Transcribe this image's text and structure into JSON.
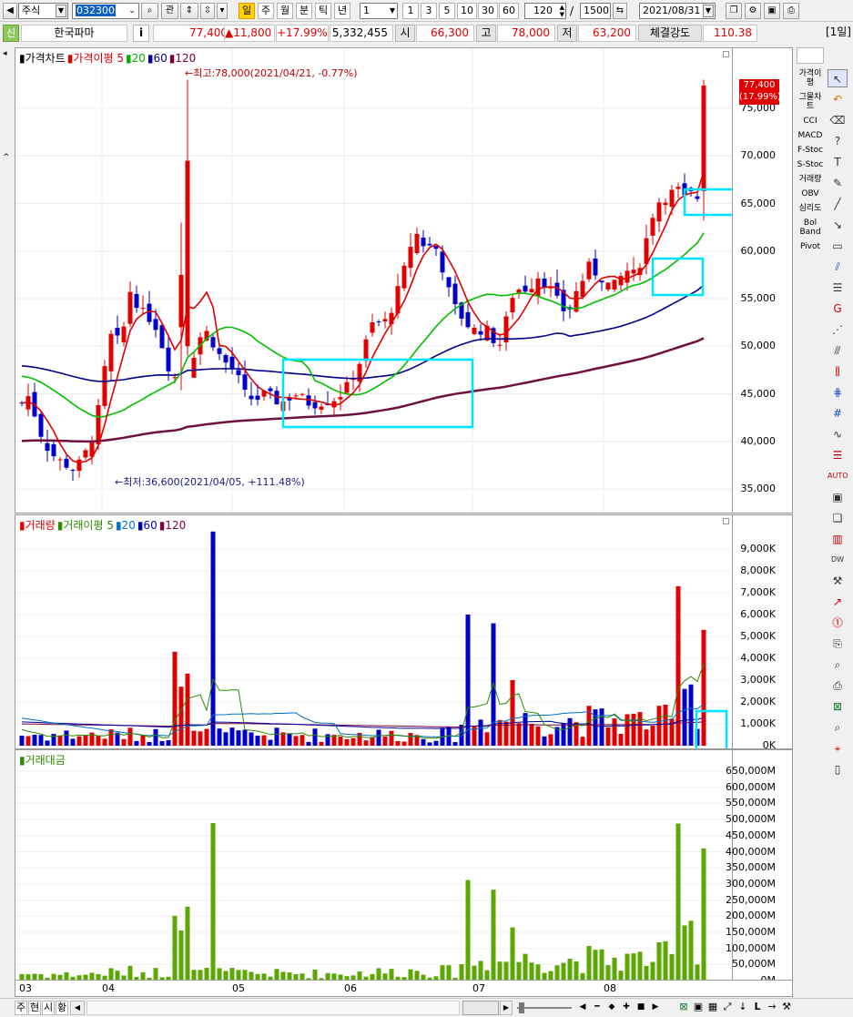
{
  "toolbar": {
    "market": "주식",
    "code": "032300",
    "btn_fav": "관",
    "periods": [
      "일",
      "주",
      "월",
      "분",
      "틱",
      "년"
    ],
    "active_period": "일",
    "interval_value": "1",
    "interval_presets": [
      "1",
      "3",
      "5",
      "10",
      "30",
      "60"
    ],
    "count": "120",
    "total": "1500",
    "date": "2021/08/31"
  },
  "quote": {
    "flag": "신",
    "name": "한국파마",
    "info": "i",
    "price": "77,400",
    "change": "▲11,800",
    "change_pct": "+17.99%",
    "volume": "5,332,455",
    "open_label": "시",
    "open": "66,300",
    "high_label": "고",
    "high": "78,000",
    "low_label": "저",
    "low": "63,200",
    "strength_label": "체결강도",
    "strength": "110.38",
    "period_tag": "[1일]"
  },
  "price_panel": {
    "legend": [
      {
        "text": "가격차트",
        "color": "#000000"
      },
      {
        "text": "가격이평 5",
        "color": "#e00000"
      },
      {
        "text": "20",
        "color": "#00b000"
      },
      {
        "text": "60",
        "color": "#0000a0"
      },
      {
        "text": "120",
        "color": "#7a0040"
      }
    ],
    "high_note": "←최고:78,000(2021/04/21, -0.77%)",
    "low_note": "←최저:36,600(2021/04/05, +111.48%)",
    "last_price": "77,400",
    "last_pct": "(17.99%)",
    "y_labels": [
      "75,000",
      "70,000",
      "65,000",
      "60,000",
      "55,000",
      "50,000",
      "45,000",
      "40,000",
      "35,000"
    ]
  },
  "volume_panel": {
    "legend": [
      {
        "text": "거래량",
        "color": "#e00000"
      },
      {
        "text": "거래이평 5",
        "color": "#2e8b00"
      },
      {
        "text": "20",
        "color": "#0070c0"
      },
      {
        "text": "60",
        "color": "#0000a0"
      },
      {
        "text": "120",
        "color": "#7a0040"
      }
    ],
    "y_labels": [
      "9,000K",
      "8,000K",
      "7,000K",
      "6,000K",
      "5,000K",
      "4,000K",
      "3,000K",
      "2,000K",
      "1,000K",
      "0K"
    ]
  },
  "amount_panel": {
    "legend": [
      {
        "text": "거래대금",
        "color": "#2e8b00"
      }
    ],
    "y_labels": [
      "650,000M",
      "600,000M",
      "550,000M",
      "500,000M",
      "450,000M",
      "400,000M",
      "350,000M",
      "300,000M",
      "250,000M",
      "200,000M",
      "150,000M",
      "100,000M",
      "50,000M",
      "0M"
    ]
  },
  "x_labels": [
    "03",
    "04",
    "05",
    "06",
    "07",
    "08"
  ],
  "side_menu": [
    "가격이평",
    "그물차트",
    "CCI",
    "MACD",
    "F-Stoc",
    "S-Stoc",
    "거래량",
    "OBV",
    "심리도",
    "Bol Band",
    "Pivot"
  ],
  "bottom": {
    "tabs": [
      "주",
      "현",
      "시",
      "황"
    ]
  },
  "colors": {
    "up": "#e00000",
    "down": "#0000c8",
    "ma5": "#e00000",
    "ma20": "#00c000",
    "ma60": "#00008c",
    "ma120": "#6e1040",
    "highlight": "#00e5ff",
    "amount": "#5aa800"
  },
  "chart_data": {
    "type": "candlestick",
    "x_axis": [
      "03",
      "04",
      "05",
      "06",
      "07",
      "08"
    ],
    "price_range": [
      33000,
      80000
    ],
    "last_close": 77400,
    "period_high": 78000,
    "period_low": 36600,
    "volume_unit": "K",
    "amount_unit": "M"
  }
}
